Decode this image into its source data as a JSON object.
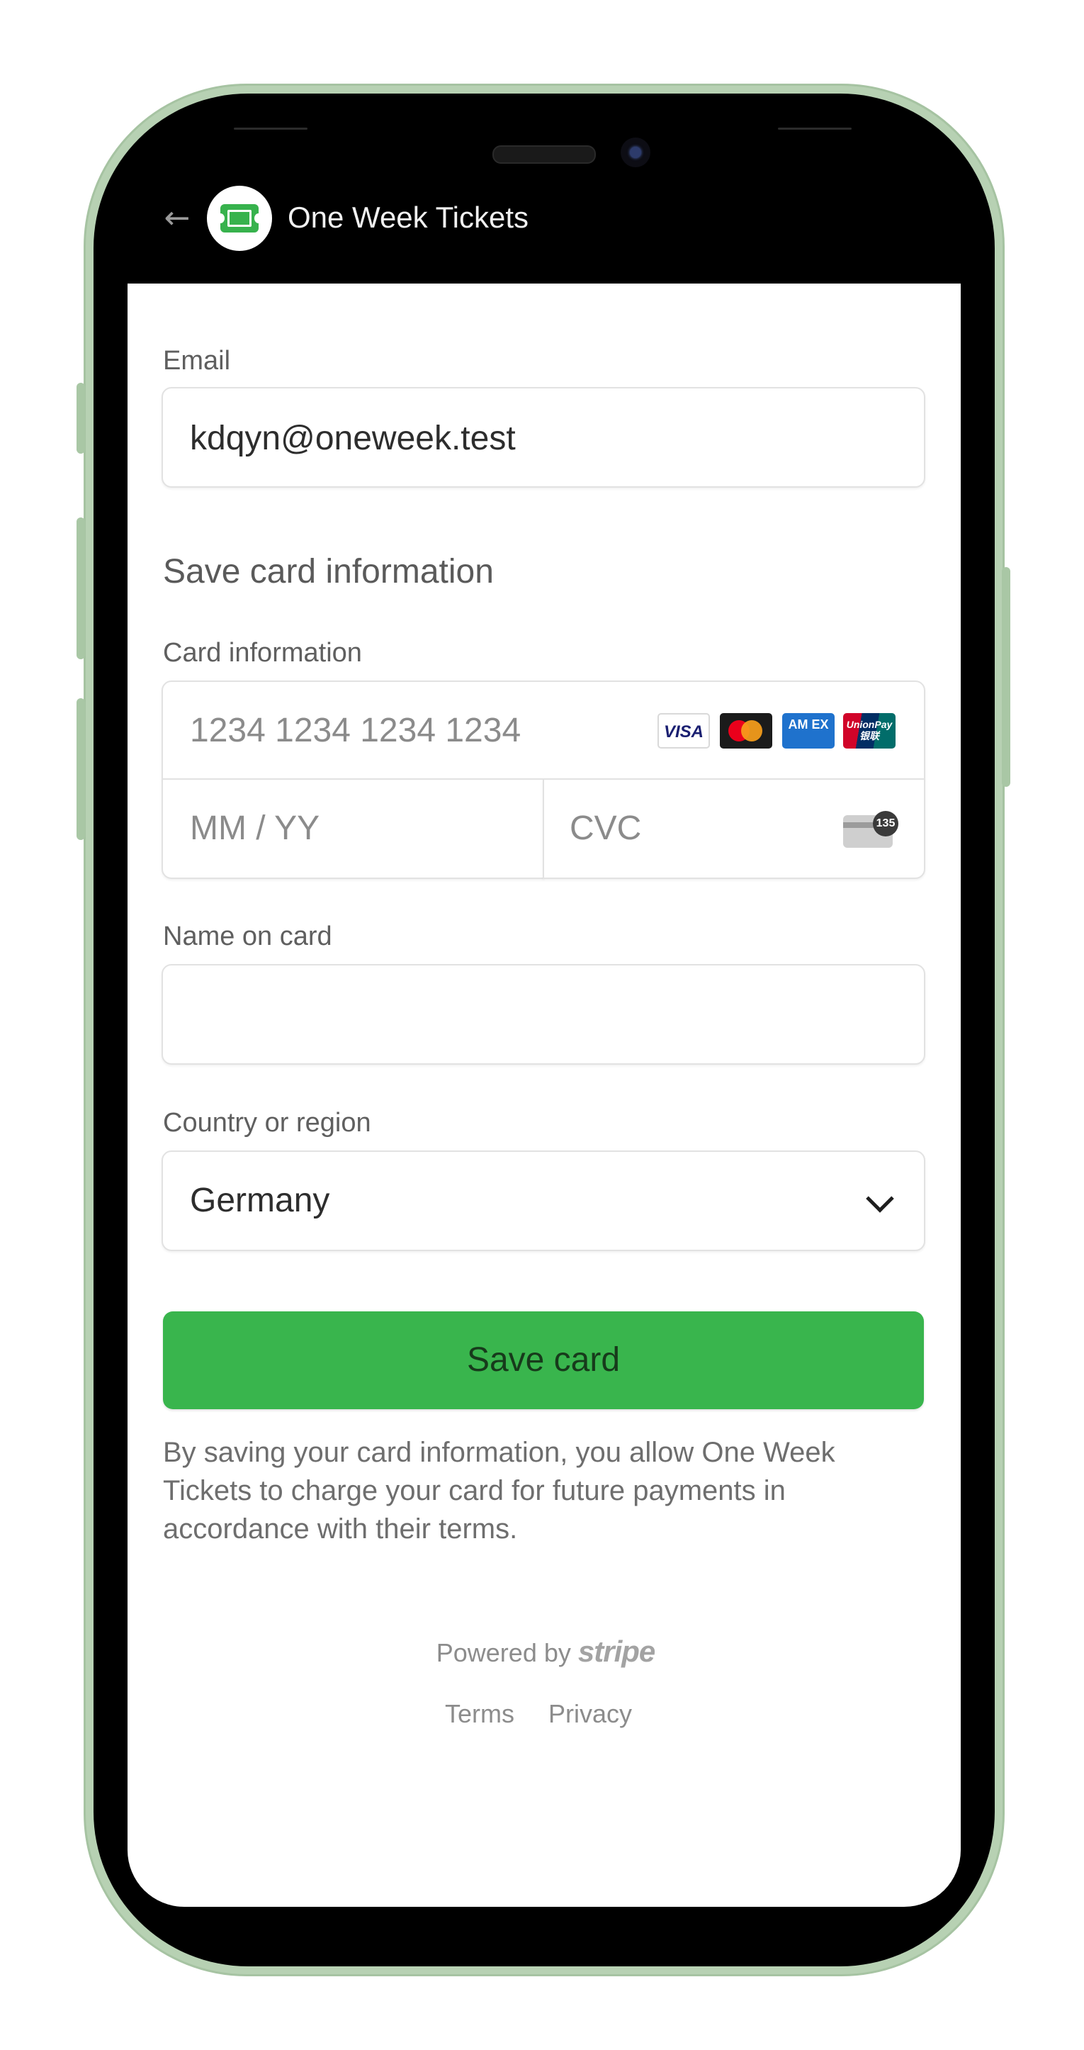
{
  "header": {
    "back_icon": "arrow-left-icon",
    "logo_icon": "ticket-icon",
    "title": "One Week Tickets"
  },
  "form": {
    "email": {
      "label": "Email",
      "value": "kdqyn@oneweek.test"
    },
    "section_title": "Save card information",
    "card": {
      "label": "Card information",
      "number_placeholder": "1234 1234 1234 1234",
      "expiry_placeholder": "MM / YY",
      "cvc_placeholder": "CVC",
      "brands": [
        "VISA",
        "Mastercard",
        "AMEX",
        "UnionPay"
      ],
      "visa_text": "VISA",
      "amex_text": "AM EX",
      "unionpay_text": "UnionPay 银联",
      "cvc_hint": "135"
    },
    "name": {
      "label": "Name on card",
      "value": ""
    },
    "country": {
      "label": "Country or region",
      "selected": "Germany"
    },
    "save_button": "Save card",
    "legal": "By saving your card information, you allow One Week Tickets to charge your card for future payments in accordance with their terms."
  },
  "footer": {
    "powered_by": "Powered by",
    "stripe": "stripe",
    "terms": "Terms",
    "privacy": "Privacy"
  },
  "colors": {
    "accent": "#39b54d",
    "frame": "#b7d1b3",
    "text_primary": "#2d2d2d",
    "text_muted": "#6e6e6e"
  }
}
